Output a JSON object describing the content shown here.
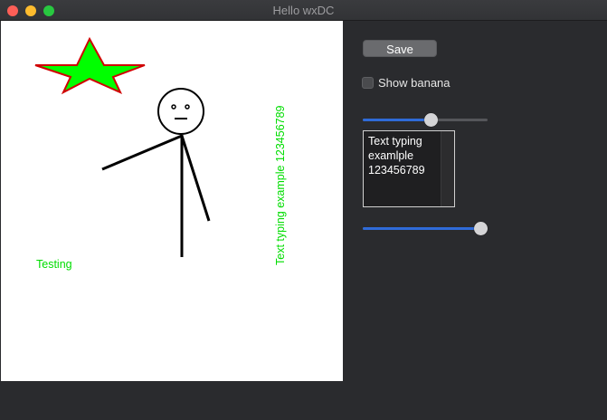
{
  "window": {
    "title": "Hello wxDC"
  },
  "canvas": {
    "label_testing": "Testing",
    "vertical_text": "Text typing example 123456789",
    "colors": {
      "star_fill": "#00ff00",
      "star_stroke": "#d00000",
      "text": "#00dd00",
      "stroke": "#000000"
    }
  },
  "controls": {
    "save_label": "Save",
    "checkbox_label": "Show banana",
    "checkbox_checked": false,
    "slider_top_value": 0.55,
    "slider_bottom_value": 1.0,
    "textarea_value": "Text typing examlple 123456789"
  },
  "icons": [
    "close-icon",
    "minimize-icon",
    "zoom-icon"
  ]
}
